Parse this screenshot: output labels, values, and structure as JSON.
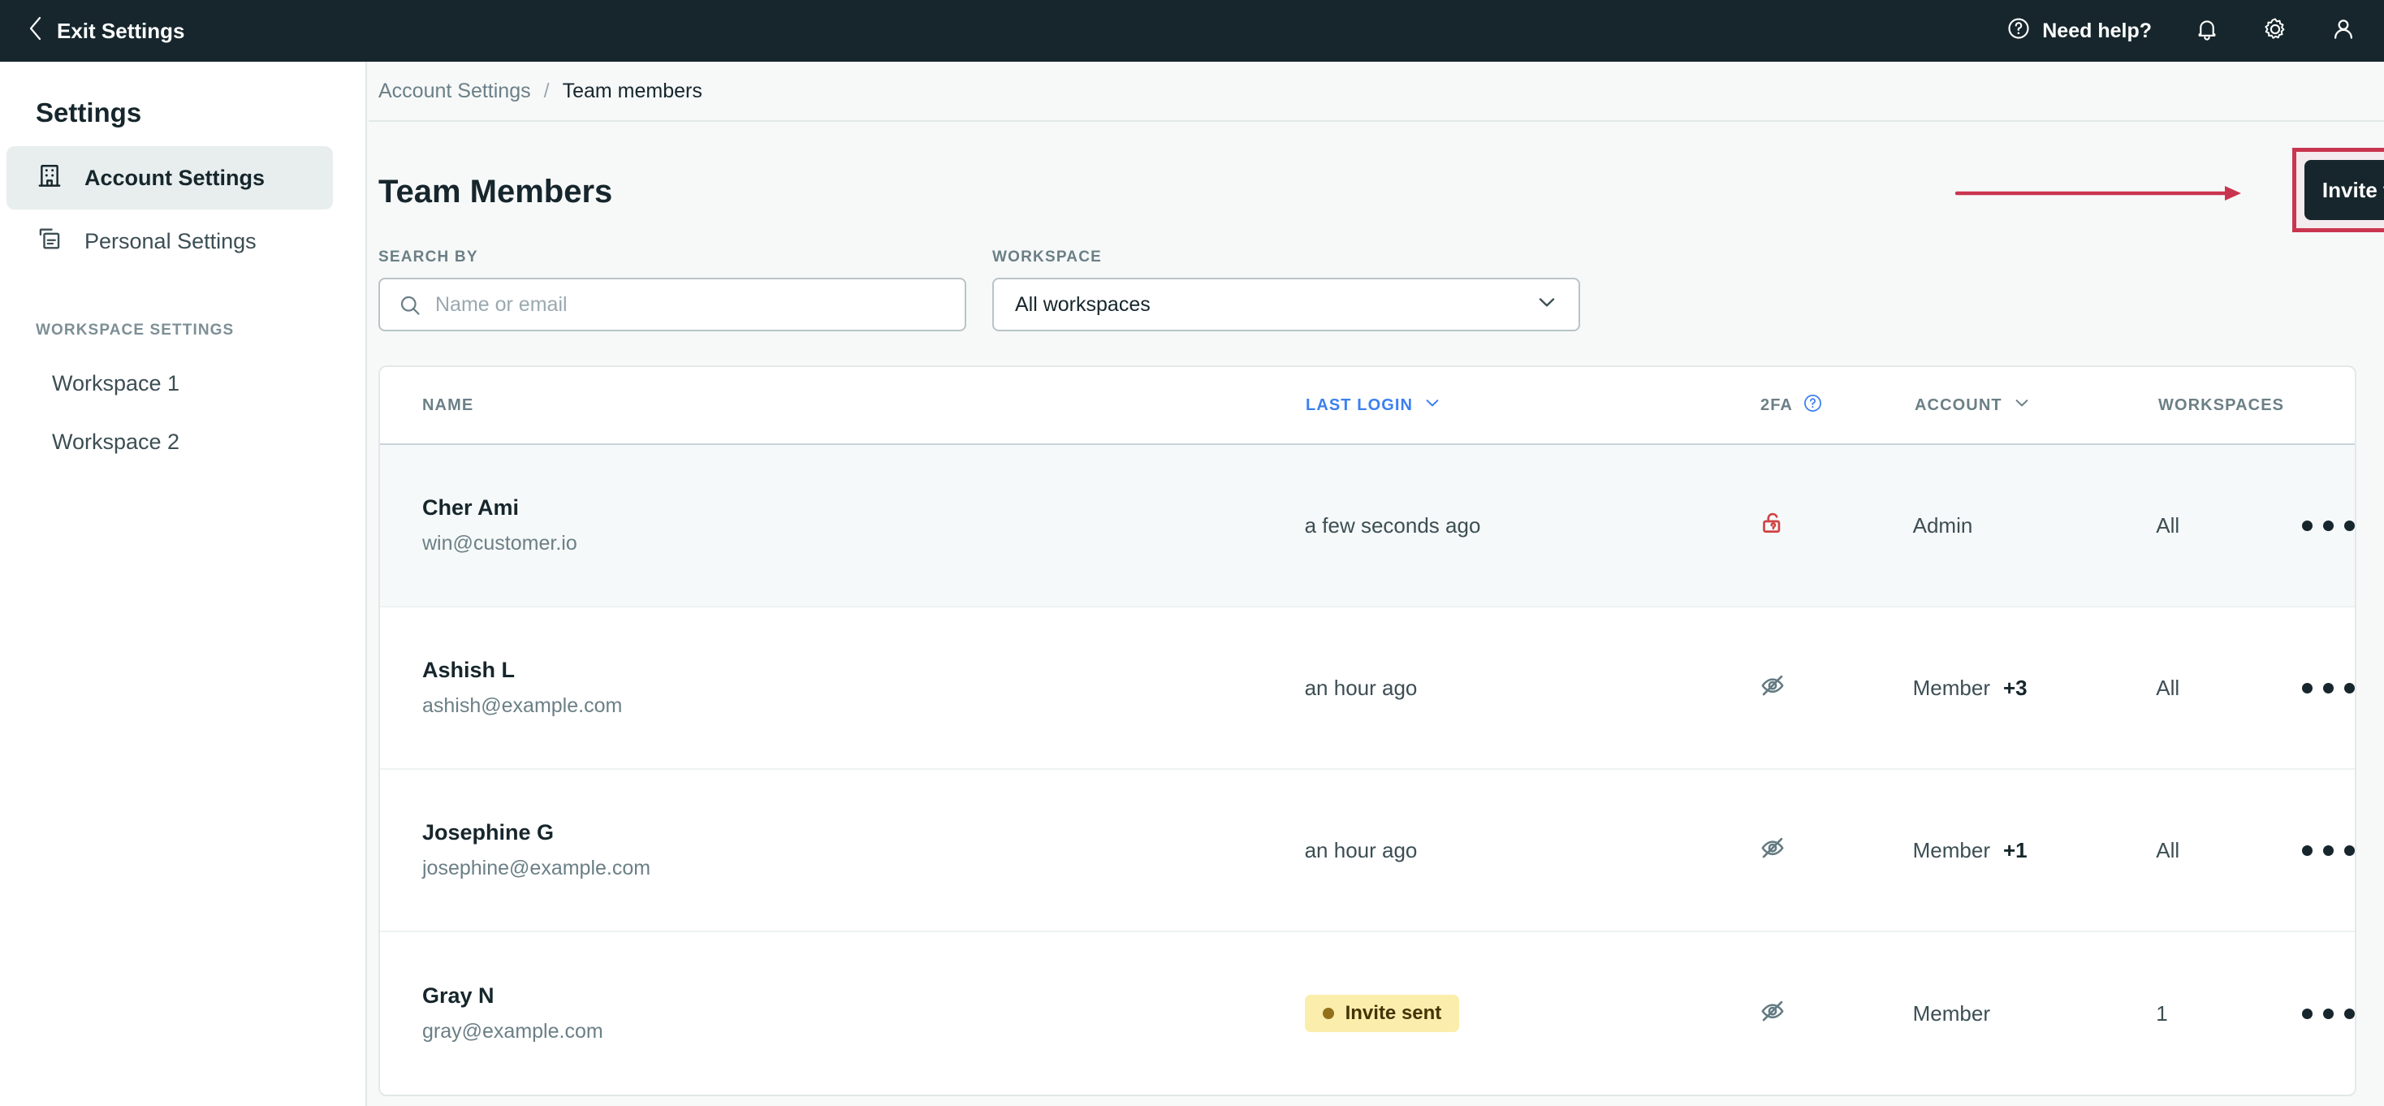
{
  "topbar": {
    "exit_label": "Exit Settings",
    "back_icon": "chevron-left-icon",
    "need_help_label": "Need help?",
    "help_icon": "question-circle-icon",
    "bell_icon": "bell-icon",
    "gear_icon": "gear-icon",
    "account_icon": "user-icon",
    "background": "#16262c"
  },
  "sidebar": {
    "title": "Settings",
    "items": [
      {
        "label": "Account Settings",
        "icon": "building-icon",
        "active": true
      },
      {
        "label": "Personal Settings",
        "icon": "card-copy-icon",
        "active": false
      }
    ],
    "workspace_section_label": "WORKSPACE SETTINGS",
    "workspaces": [
      {
        "label": "Workspace 1"
      },
      {
        "label": "Workspace 2"
      }
    ]
  },
  "breadcrumb": {
    "parent": "Account Settings",
    "separator": "/",
    "current": "Team members"
  },
  "page": {
    "title": "Team Members",
    "invite_button_label": "Invite team member",
    "invite_button_color": "#16262c"
  },
  "annotation": {
    "highlight_color": "#c9354f",
    "arrow_name": "red-arrow-annotation",
    "box_name": "red-highlight-box-annotation"
  },
  "filters": {
    "search_label": "SEARCH BY",
    "search_placeholder": "Name or email",
    "search_value": "",
    "search_icon": "search-icon",
    "workspace_label": "WORKSPACE",
    "workspace_value": "All workspaces",
    "workspace_chevron": "chevron-down-icon"
  },
  "table": {
    "columns": {
      "name": "NAME",
      "last_login": "LAST LOGIN",
      "two_fa": "2FA",
      "account": "ACCOUNT",
      "workspaces": "WORKSPACES"
    },
    "sort_active_column": "LAST LOGIN",
    "sort_active_color": "#3b7ff2",
    "two_fa_help_icon": "question-circle-icon",
    "last_login_sort_icon": "chevron-down-icon",
    "account_sort_icon": "chevron-down-icon",
    "row_menu_icon": "ellipsis-icon",
    "rows": [
      {
        "name": "Cher Ami",
        "email": "win@customer.io",
        "last_login": "a few seconds ago",
        "last_login_badge": null,
        "two_fa_icon": "unlock-icon",
        "two_fa_state": "disabled-alert",
        "two_fa_color": "#d14343",
        "account": "Admin",
        "account_extra": "",
        "workspaces": "All",
        "highlighted": true
      },
      {
        "name": "Ashish L",
        "email": "ashish@example.com",
        "last_login": "an hour ago",
        "last_login_badge": null,
        "two_fa_icon": "eye-off-icon",
        "two_fa_state": "off",
        "two_fa_color": "#637a82",
        "account": "Member",
        "account_extra": "+3",
        "workspaces": "All",
        "highlighted": false
      },
      {
        "name": "Josephine G",
        "email": "josephine@example.com",
        "last_login": "an hour ago",
        "last_login_badge": null,
        "two_fa_icon": "eye-off-icon",
        "two_fa_state": "off",
        "two_fa_color": "#637a82",
        "account": "Member",
        "account_extra": "+1",
        "workspaces": "All",
        "highlighted": false
      },
      {
        "name": "Gray N",
        "email": "gray@example.com",
        "last_login": "",
        "last_login_badge": "Invite sent",
        "two_fa_icon": "eye-off-icon",
        "two_fa_state": "off",
        "two_fa_color": "#637a82",
        "account": "Member",
        "account_extra": "",
        "workspaces": "1",
        "highlighted": false
      }
    ]
  }
}
